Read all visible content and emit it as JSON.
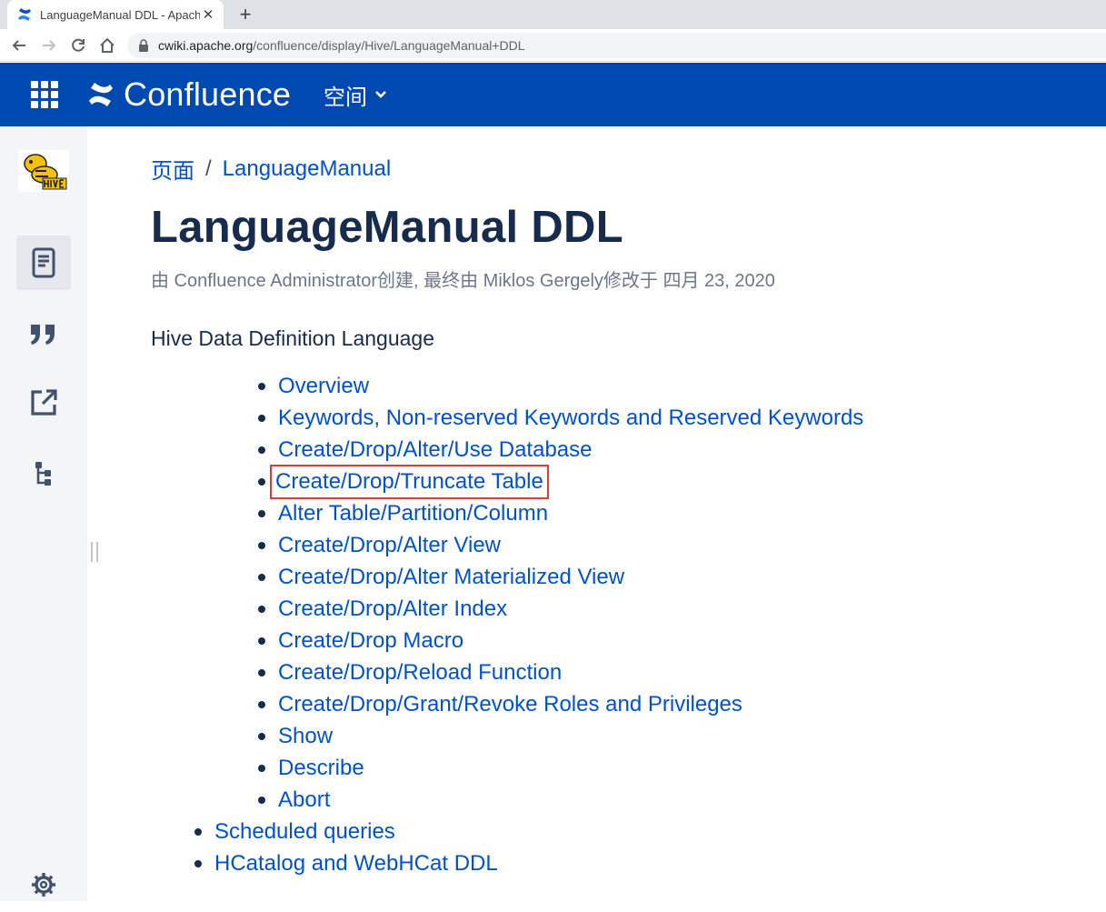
{
  "browser": {
    "tab_title": "LanguageManual DDL - Apach",
    "tab_close": "✕",
    "new_tab": "+",
    "url_host": "cwiki.apache.org",
    "url_path": "/confluence/display/Hive/LanguageManual+DDL"
  },
  "header": {
    "brand": "Confluence",
    "spaces_label": "空间",
    "bg_color": "#0049b0"
  },
  "sidebar": {
    "space_logo": "HIVE",
    "items": [
      {
        "icon": "page-icon",
        "active": true
      },
      {
        "icon": "quote-icon",
        "active": false
      },
      {
        "icon": "share-icon",
        "active": false
      },
      {
        "icon": "page-tree-icon",
        "active": false
      },
      {
        "icon": "gear-icon",
        "active": false
      }
    ]
  },
  "breadcrumb": {
    "root": "页面",
    "separator": "/",
    "parent": "LanguageManual"
  },
  "page": {
    "title": "LanguageManual DDL",
    "byline": "由 Confluence Administrator创建, 最终由 Miklos Gergely修改于 四月 23, 2020",
    "intro": "Hive Data Definition Language"
  },
  "toc": {
    "sub_items": [
      "Overview",
      "Keywords, Non-reserved Keywords and Reserved Keywords",
      "Create/Drop/Alter/Use Database",
      "Create/Drop/Truncate Table",
      "Alter Table/Partition/Column",
      "Create/Drop/Alter View",
      "Create/Drop/Alter Materialized View",
      "Create/Drop/Alter Index",
      "Create/Drop Macro",
      "Create/Drop/Reload Function",
      "Create/Drop/Grant/Revoke Roles and Privileges",
      "Show",
      "Describe",
      "Abort"
    ],
    "top_items": [
      "Scheduled queries",
      "HCatalog and WebHCat DDL"
    ],
    "highlighted": "Create/Drop/Truncate Table",
    "highlight_color": "#e53935",
    "link_color": "#0052cc"
  }
}
